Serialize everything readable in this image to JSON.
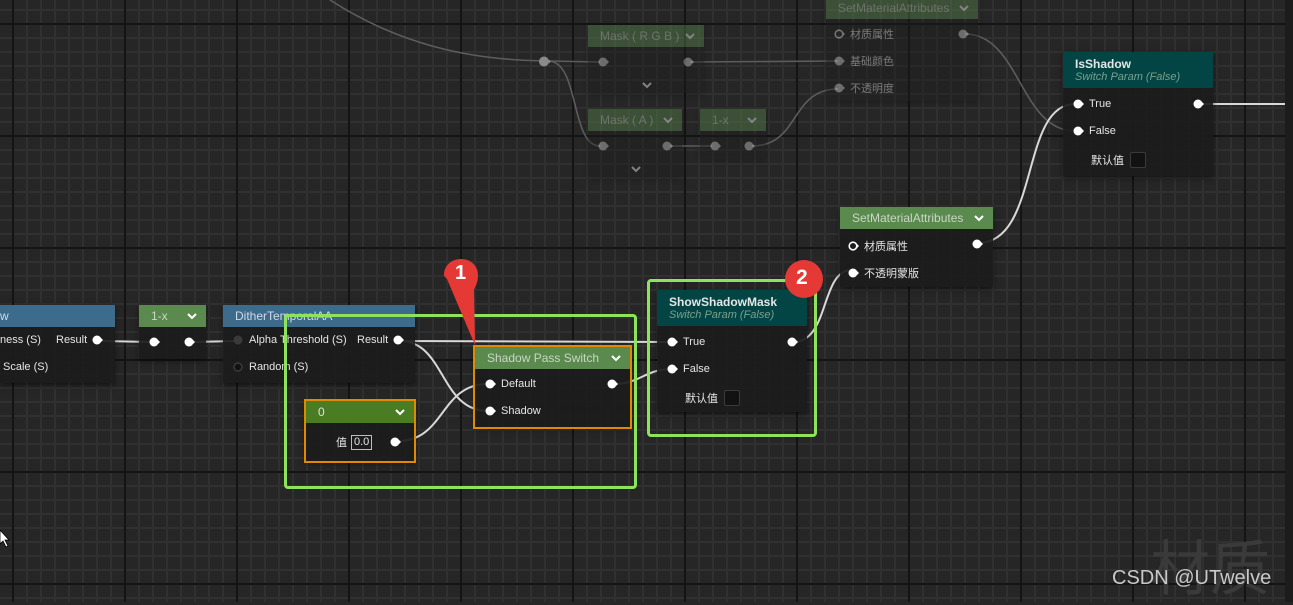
{
  "app": "Material Editor graph",
  "watermark": "CSDN @UTwelve",
  "background_watermark": "材质",
  "colors": {
    "highlight_box": "#8ee35a",
    "selection_outline": "#e08a00",
    "badge": "#e53935",
    "switch_param_header": "#024544",
    "function_header": "#3d6b8c",
    "math_header": "#5a8a4e"
  },
  "nodes": {
    "partial_left": {
      "title": "w",
      "pins_in": [
        "ness (S)",
        "Scale (S)"
      ],
      "pin_out": "Result"
    },
    "one_minus_left": {
      "title": "1-x"
    },
    "dither": {
      "title": "DitherTemporalAA",
      "pins_in": [
        "Alpha Threshold (S)",
        "Random (S)"
      ],
      "pin_out": "Result"
    },
    "constant": {
      "title": "0",
      "value_label": "值",
      "value": "0.0"
    },
    "shadow_pass_switch": {
      "title": "Shadow Pass Switch",
      "pins_in": [
        "Default",
        "Shadow"
      ]
    },
    "show_shadow_mask": {
      "title": "ShowShadowMask",
      "subtitle": "Switch Param (False)",
      "pins_in": [
        "True",
        "False"
      ],
      "default_label": "默认值"
    },
    "set_material_attrs_bottom": {
      "title": "SetMaterialAttributes",
      "pins_in": [
        "材质属性",
        "不透明蒙版"
      ]
    },
    "is_shadow": {
      "title": "IsShadow",
      "subtitle": "Switch Param (False)",
      "pins_in": [
        "True",
        "False"
      ],
      "default_label": "默认值"
    },
    "mask_rgb": {
      "title": "Mask ( R G B )"
    },
    "mask_a": {
      "title": "Mask ( A )"
    },
    "one_minus_top": {
      "title": "1-x"
    },
    "set_material_attrs_top": {
      "title": "SetMaterialAttributes",
      "pins_in": [
        "材质属性",
        "基础颜色",
        "不透明度"
      ]
    }
  },
  "badges": [
    "1",
    "2"
  ]
}
